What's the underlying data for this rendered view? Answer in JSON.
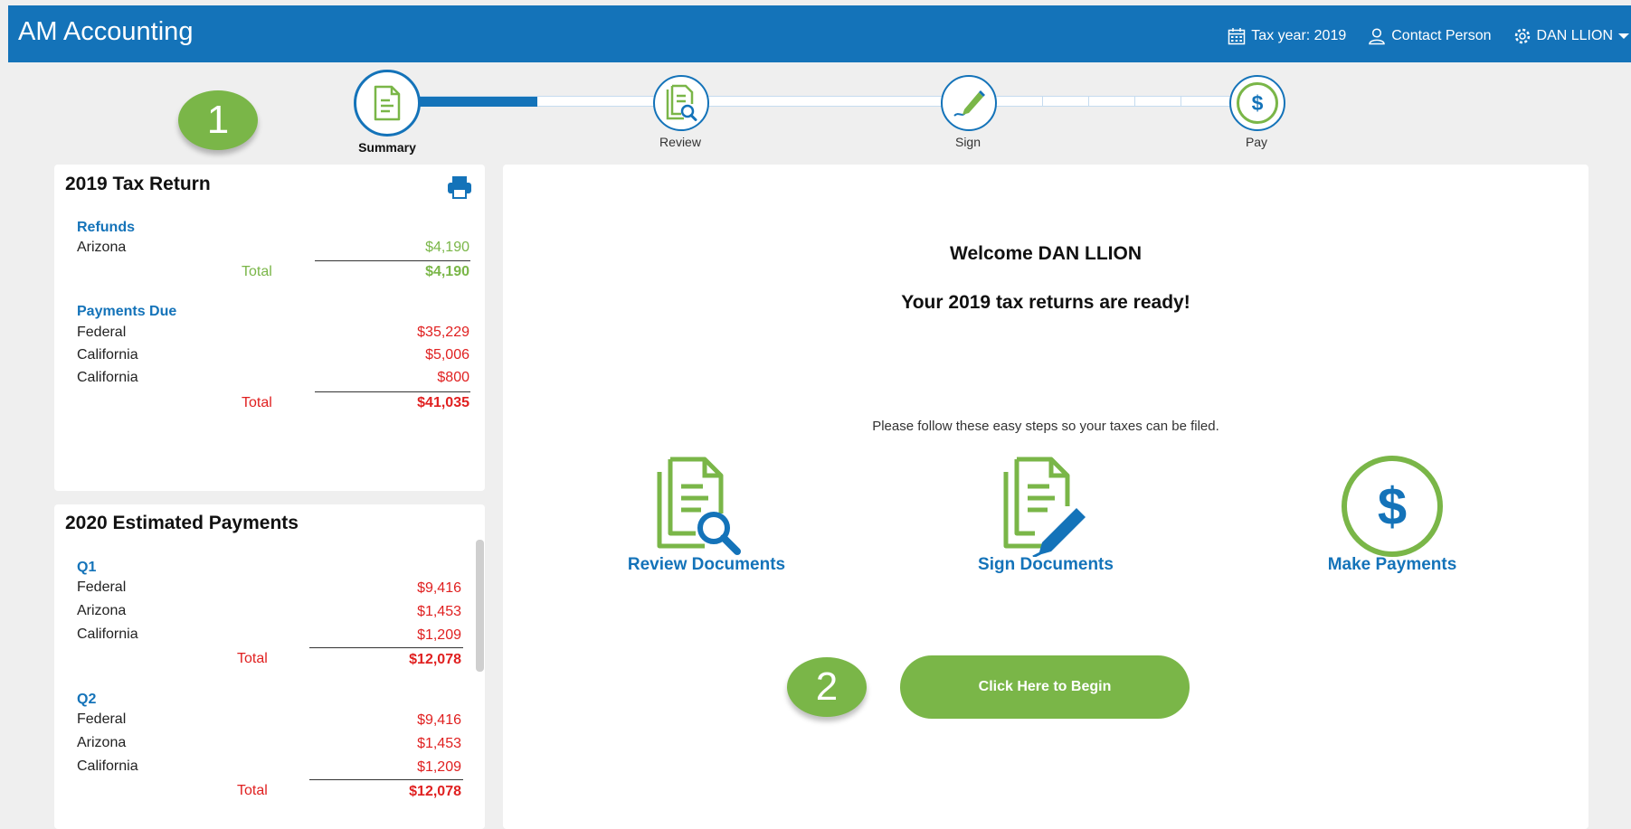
{
  "header": {
    "app_title": "AM Accounting",
    "tax_year": "Tax year: 2019",
    "contact": "Contact Person",
    "user": "DAN LLION",
    "brand_color": "#1473b9"
  },
  "callouts": {
    "one": "1",
    "two": "2",
    "color": "#7ab648"
  },
  "stepper": {
    "steps": [
      {
        "label": "Summary",
        "icon": "document-icon",
        "active": true
      },
      {
        "label": "Review",
        "icon": "review-document-icon"
      },
      {
        "label": "Sign",
        "icon": "sign-pen-icon"
      },
      {
        "label": "Pay",
        "icon": "dollar-icon"
      }
    ]
  },
  "tax_return": {
    "title": "2019 Tax Return",
    "print_icon": "print-icon",
    "refunds": {
      "heading": "Refunds",
      "rows": [
        {
          "label": "Arizona",
          "value": "$4,190"
        }
      ],
      "total_label": "Total",
      "total": "$4,190"
    },
    "payments_due": {
      "heading": "Payments Due",
      "rows": [
        {
          "label": "Federal",
          "value": "$35,229"
        },
        {
          "label": "California",
          "value": "$5,006"
        },
        {
          "label": "California",
          "value": "$800"
        }
      ],
      "total_label": "Total",
      "total": "$41,035"
    }
  },
  "estimated": {
    "title": "2020 Estimated Payments",
    "quarters": [
      {
        "heading": "Q1",
        "rows": [
          {
            "label": "Federal",
            "value": "$9,416"
          },
          {
            "label": "Arizona",
            "value": "$1,453"
          },
          {
            "label": "California",
            "value": "$1,209"
          }
        ],
        "total_label": "Total",
        "total": "$12,078"
      },
      {
        "heading": "Q2",
        "rows": [
          {
            "label": "Federal",
            "value": "$9,416"
          },
          {
            "label": "Arizona",
            "value": "$1,453"
          },
          {
            "label": "California",
            "value": "$1,209"
          }
        ],
        "total_label": "Total",
        "total": "$12,078"
      }
    ]
  },
  "main": {
    "welcome": "Welcome DAN LLION",
    "ready": "Your 2019 tax returns are ready!",
    "instructions": "Please follow these easy steps so your taxes can be filed.",
    "actions": [
      {
        "label": "Review Documents",
        "icon": "review-document-icon"
      },
      {
        "label": "Sign Documents",
        "icon": "sign-document-icon"
      },
      {
        "label": "Make Payments",
        "icon": "dollar-icon"
      }
    ],
    "begin_button": "Click Here to Begin"
  }
}
